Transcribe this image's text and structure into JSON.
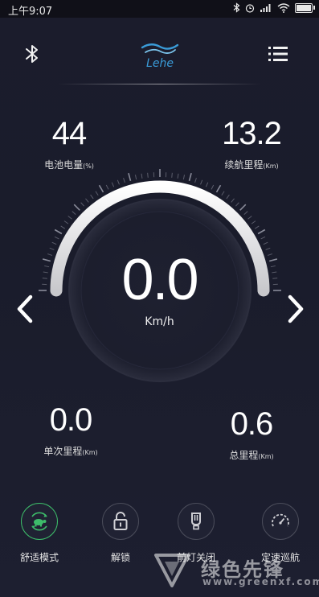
{
  "status_bar": {
    "time": "上午9:07",
    "battery_level": 0.92
  },
  "header": {
    "logo_text": "Lehe"
  },
  "battery": {
    "value": "44",
    "label": "电池电量",
    "unit": "(%)"
  },
  "range": {
    "value": "13.2",
    "label": "续航里程",
    "unit": "(Km)"
  },
  "speed": {
    "value": "0.0",
    "unit": "Km/h",
    "arc_fraction": 1.0
  },
  "trip": {
    "value": "0.0",
    "label": "单次里程",
    "unit": "(Km)"
  },
  "total": {
    "value": "0.6",
    "label": "总里程",
    "unit": "(Km)"
  },
  "modes": [
    {
      "label": "舒适模式",
      "active": true
    },
    {
      "label": "解锁",
      "active": false
    },
    {
      "label": "前灯关闭",
      "active": false
    },
    {
      "label": "定速巡航",
      "active": false
    }
  ],
  "watermark": {
    "title": "绿色先锋",
    "url": "www.greenxf.com"
  },
  "colors": {
    "accent_green": "#3dbd6a",
    "logo_blue": "#3a9bd8",
    "background": "#1b1c2c"
  }
}
